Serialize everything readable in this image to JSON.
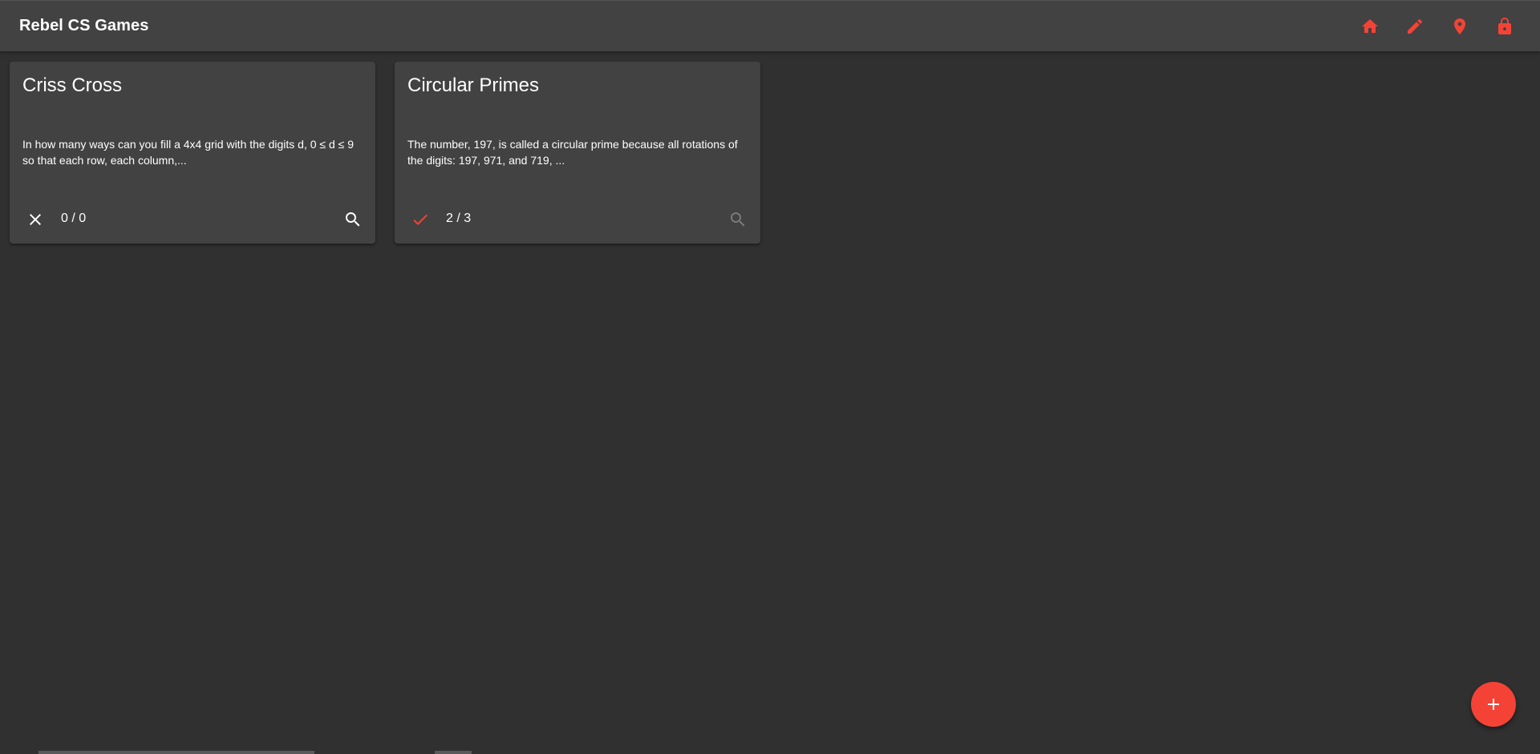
{
  "app": {
    "title": "Rebel CS Games",
    "accent_color": "#f44336"
  },
  "toolbar": {
    "actions": [
      {
        "icon": "home-icon"
      },
      {
        "icon": "pencil-icon"
      },
      {
        "icon": "location-pin-icon"
      },
      {
        "icon": "lock-icon"
      }
    ]
  },
  "cards": [
    {
      "title": "Criss Cross",
      "description": "In how many ways can you fill a 4x4 grid with the digits d, 0 ≤ d ≤ 9 so that each row, each column,...",
      "status_icon": "close-icon",
      "score": "0 / 0",
      "search_enabled": true
    },
    {
      "title": "Circular Primes",
      "description": "The number, 197, is called a circular prime because all rotations of the digits: 197, 971, and 719, ...",
      "status_icon": "check-icon",
      "score": "2 / 3",
      "search_enabled": false
    }
  ],
  "fab": {
    "icon": "add-icon"
  }
}
